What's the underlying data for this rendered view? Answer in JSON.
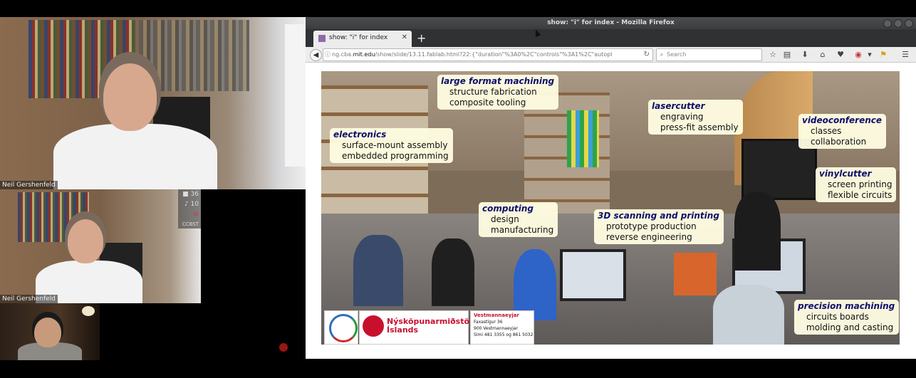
{
  "videoconference": {
    "main_speaker": "Neil Gershenfeld",
    "second_speaker": "Neil Gershenfeld",
    "stats": {
      "video": "36",
      "audio": "10",
      "room": "CCBST"
    }
  },
  "browser": {
    "window_title": "show: \"i\" for index - Mozilla Firefox",
    "tab_label": "show: \"i\" for index",
    "new_tab": "+",
    "url_host": "ng.cba.mit.edu",
    "url_prefix": "ng.cba.",
    "url_rest": "/show/slide/13.11.fablab.html?22:{\"duration\"%3A0%2C\"controls\"%3A1%2C\"autopl",
    "search_placeholder": "Search"
  },
  "slide": {
    "callouts": [
      {
        "head": "large format machining",
        "lines": [
          "structure fabrication",
          "composite tooling"
        ]
      },
      {
        "head": "lasercutter",
        "lines": [
          "engraving",
          "press-fit assembly"
        ]
      },
      {
        "head": "videoconference",
        "lines": [
          "classes",
          "collaboration"
        ]
      },
      {
        "head": "electronics",
        "lines": [
          "surface-mount assembly",
          "embedded programming"
        ]
      },
      {
        "head": "vinylcutter",
        "lines": [
          "screen printing",
          "flexible circuits"
        ]
      },
      {
        "head": "computing",
        "lines": [
          "design",
          "manufacturing"
        ]
      },
      {
        "head": "3D scanning and printing",
        "lines": [
          "prototype production",
          "reverse engineering"
        ]
      },
      {
        "head": "precision machining",
        "lines": [
          "circuits boards",
          "molding and casting"
        ]
      }
    ],
    "logos": {
      "nsk_line1": "Nýsköpunarmiðstöð",
      "nsk_line2": "Íslands",
      "vm_title": "Vestmannaeyjar",
      "vm_line1": "Faxastígur 36",
      "vm_line2": "900 Vestmannaeyjar",
      "vm_line3": "Sími 481 3355 og 861 5032"
    }
  }
}
